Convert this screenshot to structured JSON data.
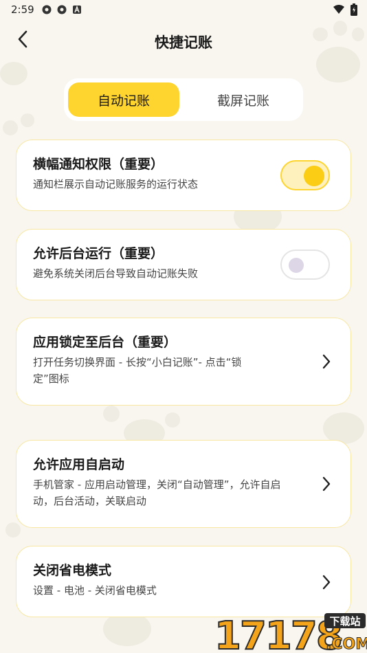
{
  "status_bar": {
    "time": "2:59",
    "icons": [
      "gear-icon",
      "gear-icon",
      "a-badge-icon"
    ],
    "right_icons": [
      "wifi-icon",
      "battery-icon"
    ]
  },
  "header": {
    "title": "快捷记账",
    "back_icon": "chevron-left-icon"
  },
  "tabs": [
    {
      "label": "自动记账",
      "active": true
    },
    {
      "label": "截屏记账",
      "active": false
    }
  ],
  "cards": [
    {
      "title": "横幅通知权限（重要）",
      "desc": "通知栏展示自动记账服务的运行状态",
      "control": "toggle",
      "on": true
    },
    {
      "title": "允许后台运行（重要）",
      "desc": "避免系统关闭后台导致自动记账失败",
      "control": "toggle",
      "on": false
    },
    {
      "title": "应用锁定至后台（重要）",
      "desc": "打开任务切换界面 - 长按“小白记账”- 点击“锁定”图标",
      "control": "chevron"
    },
    {
      "title": "允许应用自启动",
      "desc": "手机管家 - 应用启动管理，关闭“自动管理”，允许自启动，后台活动，关联启动",
      "control": "chevron"
    },
    {
      "title": "关闭省电模式",
      "desc": "设置 - 电池 - 关闭省电模式",
      "control": "chevron"
    }
  ],
  "watermark": {
    "text": "17178",
    "sub": ".COM",
    "badge": "下载站"
  },
  "colors": {
    "accent": "#fed42e",
    "background": "#f8f6ef",
    "card_border": "#f8e7a3"
  }
}
